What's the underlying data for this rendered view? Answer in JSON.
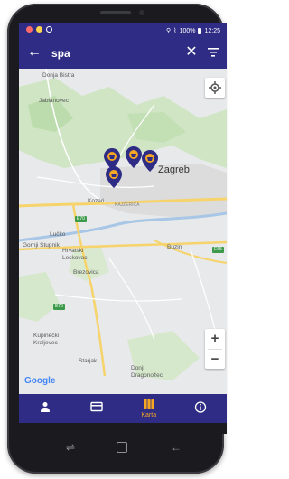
{
  "status_bar": {
    "battery": "100%",
    "time": "12:25"
  },
  "app_bar": {
    "back_icon": "arrow-left-icon",
    "search_query": "spa",
    "clear_icon": "close-icon",
    "filter_icon": "filter-icon"
  },
  "map": {
    "city": "Zagreb",
    "places": [
      "Donja Bistra",
      "Jablanovec",
      "Kozari",
      "KAJZERICA",
      "Lučko",
      "Gornji Stupnik",
      "Hrvatski Leskovac",
      "Brezovica",
      "Buzin",
      "Kupinečki Kraljevec",
      "Starjak",
      "Donji Dragonožec"
    ],
    "route_badges": [
      "E70",
      "E65",
      "E70"
    ],
    "attribution": "Google",
    "locate_icon": "my-location-icon",
    "zoom_in": "+",
    "zoom_out": "−",
    "pin_count": 4,
    "colors": {
      "primary": "#2e2c84",
      "accent": "#f5a623",
      "highway": "#f6d36b"
    }
  },
  "bottom_nav": {
    "items": [
      {
        "icon": "person-icon",
        "label": ""
      },
      {
        "icon": "card-icon",
        "label": ""
      },
      {
        "icon": "map-icon",
        "label": "Karta",
        "active": true
      },
      {
        "icon": "info-icon",
        "label": ""
      }
    ]
  }
}
